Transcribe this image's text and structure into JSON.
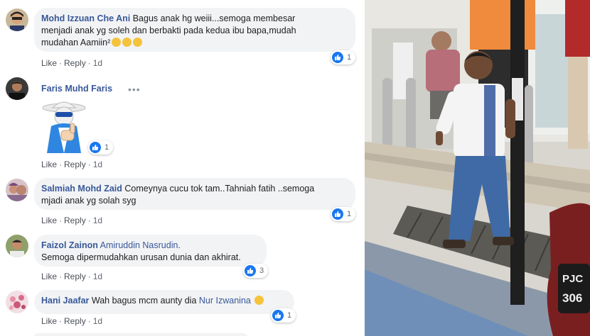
{
  "comments": [
    {
      "name": "Mohd Izzuan Che Ani",
      "text_line1": "Bagus anak hg weiii...semoga membesar",
      "text_line2": "menjadi anak yg soleh dan berbakti pada kedua ibu bapa,mudah",
      "text_line3": "mudahan Aamiin²",
      "reactions": "1",
      "like": "Like",
      "reply": "Reply",
      "time": "1d"
    },
    {
      "name": "Faris Muhd Faris",
      "sticker": "thumbs-up-cartoon-sticker",
      "reactions": "1",
      "like": "Like",
      "reply": "Reply",
      "time": "1d"
    },
    {
      "name": "Salmiah Mohd Zaid",
      "text_line1": "Comeynya cucu tok tam..Tahniah fatih ..semoga",
      "text_line2": "mjadi anak yg solah syg",
      "reactions": "1",
      "like": "Like",
      "reply": "Reply",
      "time": "1d"
    },
    {
      "name": "Faizol Zainon",
      "tag": "Amiruddin Nasrudin.",
      "text_line1": "Semoga dipermudahkan urusan dunia dan akhirat.",
      "reactions": "3",
      "like": "Like",
      "reply": "Reply",
      "time": "1d"
    },
    {
      "name": "Hani Jaafar",
      "text_line1": "Wah bagus mcm aunty dia",
      "tag": "Nur Izwanina",
      "reactions": "1",
      "like": "Like",
      "reply": "Reply",
      "time": "1d"
    }
  ],
  "more_options_icon": "ellipsis-icon",
  "photo": {
    "plate_text_1": "PJC",
    "plate_text_2": "306"
  },
  "colors": {
    "name_link": "#385898",
    "bubble": "#f2f3f5",
    "like_blue": "#1877f2"
  }
}
